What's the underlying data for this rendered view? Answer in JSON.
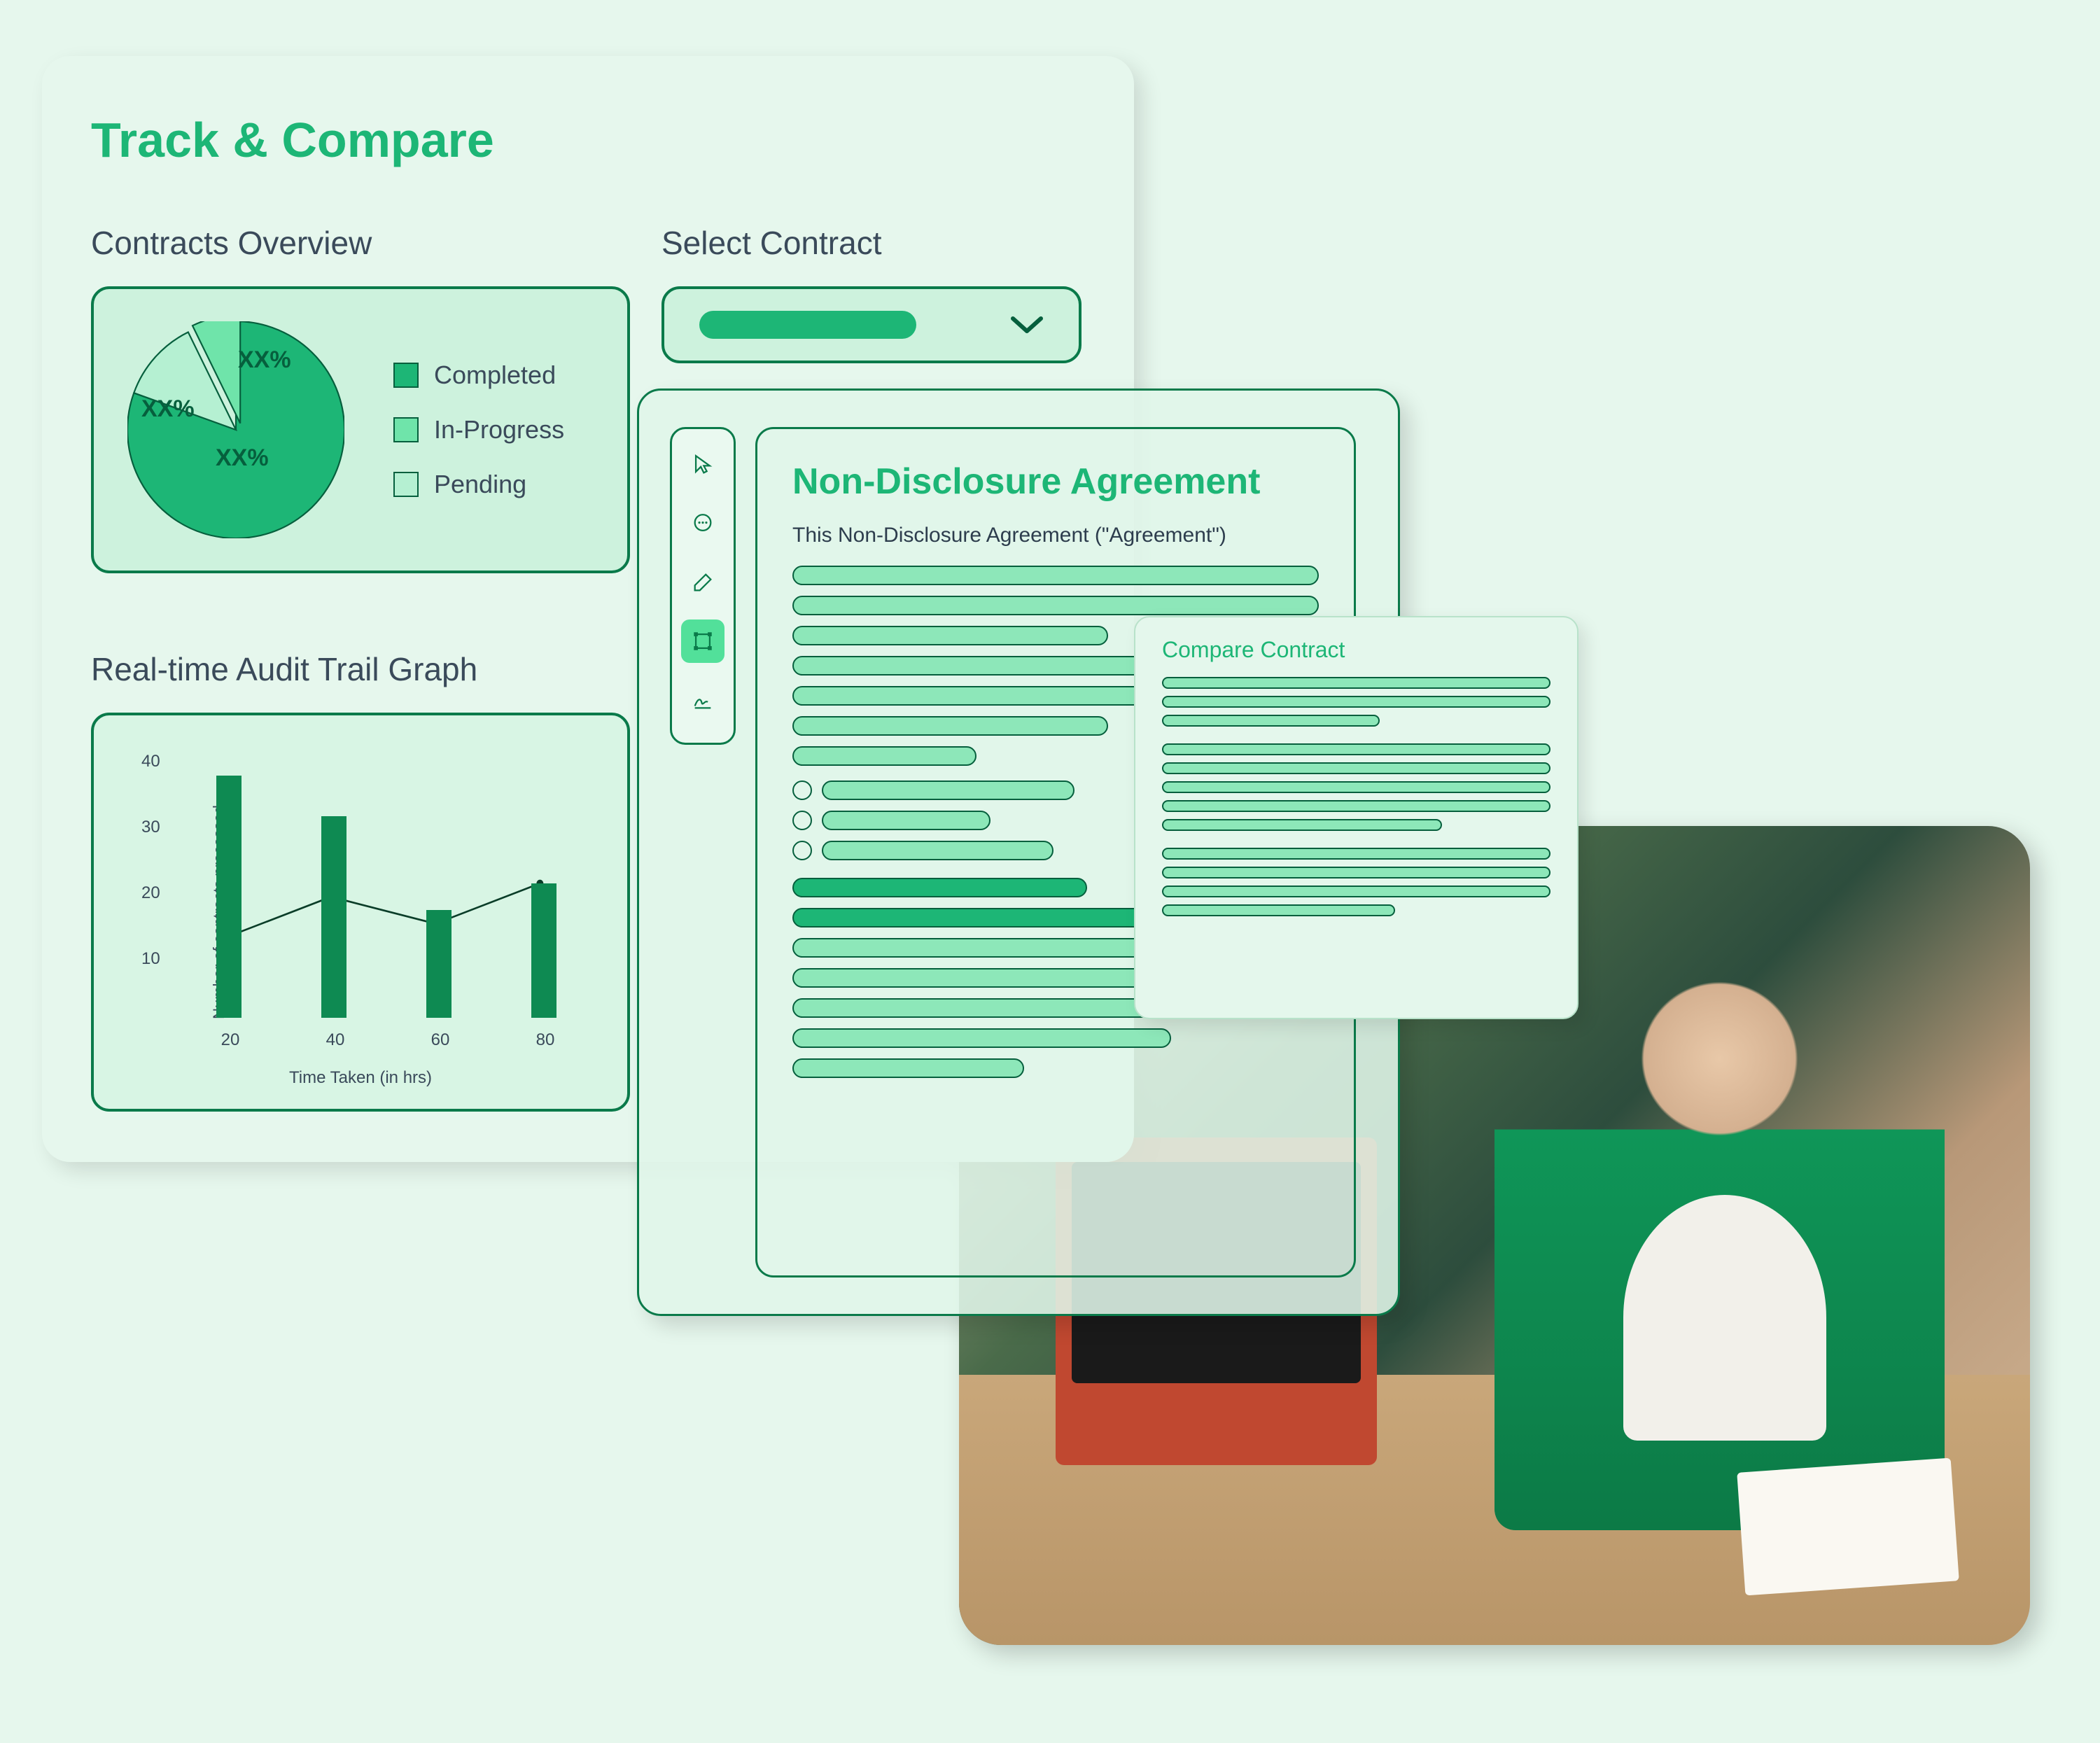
{
  "dashboard": {
    "title": "Track & Compare",
    "overview": {
      "title": "Contracts Overview",
      "slice_label_1": "XX%",
      "slice_label_2": "XX%",
      "slice_label_3": "XX%",
      "legend": {
        "completed": "Completed",
        "in_progress": "In-Progress",
        "pending": "Pending"
      }
    },
    "select": {
      "title": "Select Contract"
    },
    "graph": {
      "title": "Real-time Audit Trail Graph",
      "y_label": "Number of contracts processed",
      "x_label": "Time Taken (in hrs)"
    }
  },
  "document": {
    "title": "Non-Disclosure Agreement",
    "intro": "This Non-Disclosure Agreement (\"Agreement\")"
  },
  "compare": {
    "title": "Compare Contract"
  },
  "colors": {
    "completed": "#1db676",
    "in_progress": "#6fe4aa",
    "pending": "#b5f0d2"
  },
  "chart_data": [
    {
      "type": "pie",
      "title": "Contracts Overview",
      "series": [
        {
          "name": "Completed",
          "label": "XX%",
          "color": "#1db676"
        },
        {
          "name": "In-Progress",
          "label": "XX%",
          "color": "#6fe4aa"
        },
        {
          "name": "Pending",
          "label": "XX%",
          "color": "#b5f0d2"
        }
      ]
    },
    {
      "type": "bar",
      "title": "Real-time Audit Trail Graph",
      "xlabel": "Time Taken (in hrs)",
      "ylabel": "Number of contracts processed",
      "ylim": [
        0,
        40
      ],
      "y_ticks": [
        10,
        20,
        30,
        40
      ],
      "categories": [
        "20",
        "40",
        "60",
        "80"
      ],
      "values": [
        36,
        30,
        16,
        20
      ],
      "overlay_line": [
        12,
        18,
        14,
        20
      ]
    }
  ]
}
